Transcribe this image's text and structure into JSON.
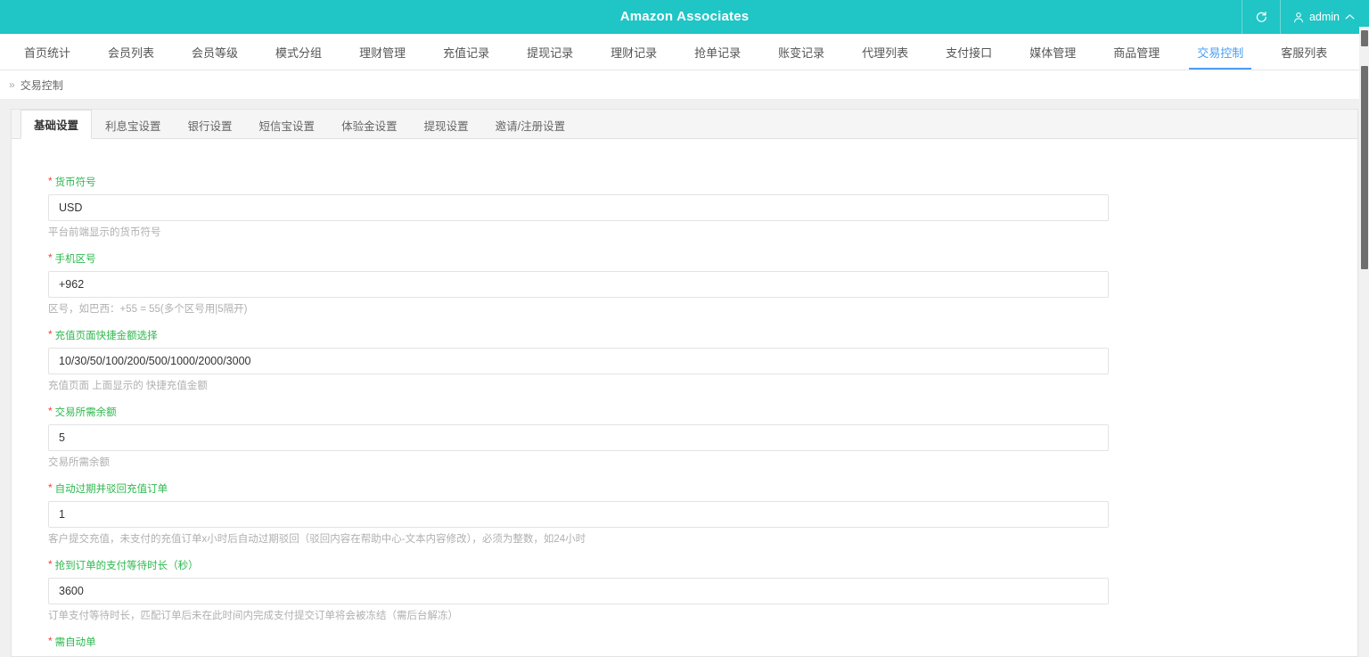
{
  "topbar": {
    "title": "Amazon Associates",
    "refresh_icon": "refresh-icon",
    "user_icon": "user-icon",
    "username": "admin",
    "chevron_icon": "chevron-up-icon",
    "bg_color": "#20c5c5"
  },
  "nav": {
    "accent_color": "#4a9ff5",
    "items": [
      {
        "label": "首页统计",
        "active": false
      },
      {
        "label": "会员列表",
        "active": false
      },
      {
        "label": "会员等级",
        "active": false
      },
      {
        "label": "模式分组",
        "active": false
      },
      {
        "label": "理财管理",
        "active": false
      },
      {
        "label": "充值记录",
        "active": false
      },
      {
        "label": "提现记录",
        "active": false
      },
      {
        "label": "理财记录",
        "active": false
      },
      {
        "label": "抢单记录",
        "active": false
      },
      {
        "label": "账变记录",
        "active": false
      },
      {
        "label": "代理列表",
        "active": false
      },
      {
        "label": "支付接口",
        "active": false
      },
      {
        "label": "媒体管理",
        "active": false
      },
      {
        "label": "商品管理",
        "active": false
      },
      {
        "label": "交易控制",
        "active": true
      },
      {
        "label": "客服列表",
        "active": false
      }
    ]
  },
  "breadcrumb": {
    "separator": "»",
    "current": "交易控制"
  },
  "tabs": {
    "items": [
      {
        "label": "基础设置",
        "active": true
      },
      {
        "label": "利息宝设置",
        "active": false
      },
      {
        "label": "银行设置",
        "active": false
      },
      {
        "label": "短信宝设置",
        "active": false
      },
      {
        "label": "体验金设置",
        "active": false
      },
      {
        "label": "提现设置",
        "active": false
      },
      {
        "label": "邀请/注册设置",
        "active": false
      }
    ]
  },
  "form": {
    "label_color": "#2db84d",
    "required_marker": "*",
    "fields": [
      {
        "label": "货币符号",
        "value": "USD",
        "help": "平台前端显示的货币符号",
        "required": true
      },
      {
        "label": "手机区号",
        "value": "+962",
        "help": "区号，如巴西：+55 = 55(多个区号用|5隔开)",
        "required": true
      },
      {
        "label": "充值页面快捷金额选择",
        "value": "10/30/50/100/200/500/1000/2000/3000",
        "help": "充值页面 上面显示的 快捷充值金额",
        "required": true
      },
      {
        "label": "交易所需余额",
        "value": "5",
        "help": "交易所需余额",
        "required": true
      },
      {
        "label": "自动过期并驳回充值订单",
        "value": "1",
        "help": "客户提交充值，未支付的充值订单x小时后自动过期驳回（驳回内容在帮助中心-文本内容修改），必须为整数，如24小时",
        "required": true
      },
      {
        "label": "抢到订单的支付等待时长（秒）",
        "value": "3600",
        "help": "订单支付等待时长，匹配订单后未在此时间内完成支付提交订单将会被冻结（需后台解冻）",
        "required": true
      },
      {
        "label": "需自动单",
        "value": "",
        "help": "",
        "required": true
      }
    ]
  }
}
